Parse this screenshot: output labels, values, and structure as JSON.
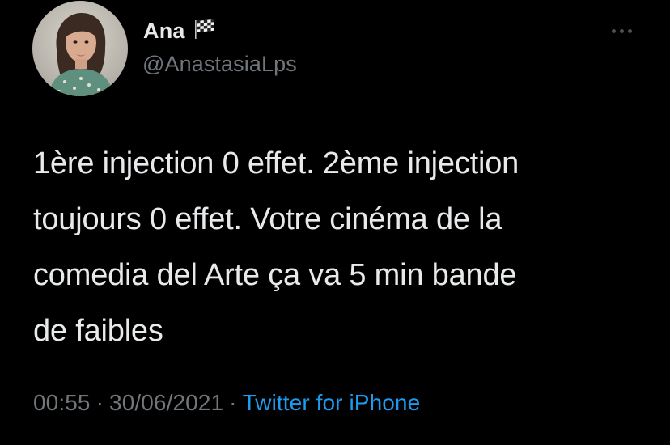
{
  "tweet": {
    "author": {
      "display_name": "Ana",
      "handle": "@AnastasiaLps",
      "name_emoji_icon": "chequered-flag-icon",
      "avatar_icon": "profile-photo"
    },
    "text": "1ère injection 0 effet. 2ème injection\ntoujours 0 effet. Votre cinéma de la\ncomedia del Arte ça va 5 min bande\nde faibles",
    "time": "00:55",
    "separator": "·",
    "date": "30/06/2021",
    "source": "Twitter for iPhone",
    "more_icon": "more-options-icon"
  },
  "colors": {
    "background": "#000000",
    "primary_text": "#e7e9ea",
    "secondary_text": "#71767b",
    "link": "#1d9bf0"
  }
}
